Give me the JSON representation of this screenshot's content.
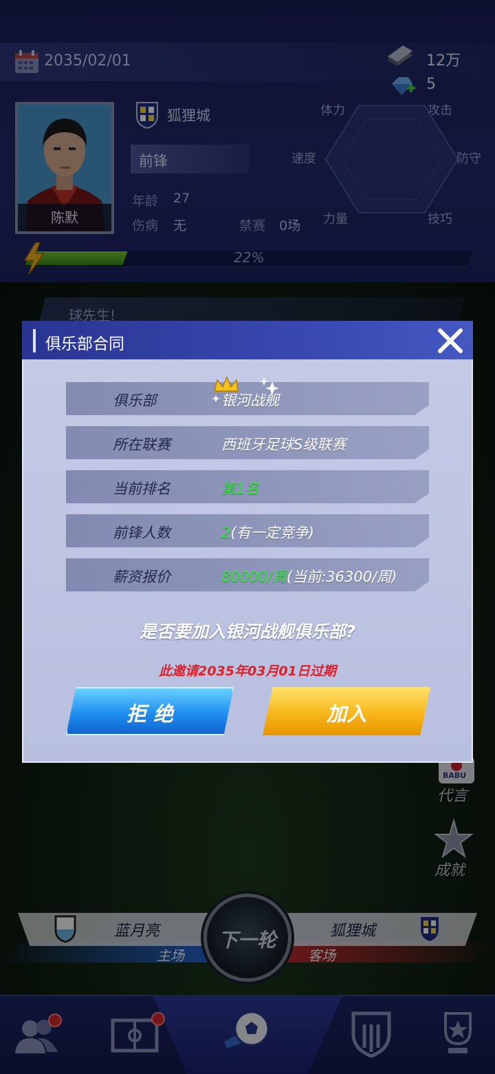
{
  "header": {
    "date": "2035/02/01",
    "money": "12万",
    "gems": "5",
    "player_name": "陈默",
    "club_name": "狐狸城",
    "position": "前锋",
    "age_label": "年龄",
    "age": "27",
    "injury_label": "伤病",
    "injury": "无",
    "ban_label": "禁赛",
    "ban": "0场",
    "energy_text": "22%",
    "energy_fraction": 0.22,
    "radar_labels": {
      "stamina": "体力",
      "attack": "攻击",
      "speed": "速度",
      "defense": "防守",
      "strength": "力量",
      "technique": "技巧"
    }
  },
  "background": {
    "banner_text": "球先生!",
    "side_buttons": [
      "代言",
      "成就"
    ],
    "sponsor_badge": "BABU"
  },
  "match": {
    "home_team": "蓝月亮",
    "home_label": "主场",
    "away_team": "狐狸城",
    "away_label": "客场",
    "next_round": "下一轮"
  },
  "dialog": {
    "title": "俱乐部合同",
    "rows": [
      {
        "label": "俱乐部",
        "value": "银河战舰",
        "value_suffix": ""
      },
      {
        "label": "所在联赛",
        "value": "西班牙足球S级联赛",
        "value_suffix": ""
      },
      {
        "label": "当前排名",
        "value": "第1名",
        "value_suffix": ""
      },
      {
        "label": "前锋人数",
        "value": "2",
        "value_suffix": "(有一定竞争)"
      },
      {
        "label": "薪资报价",
        "value": "80000/周",
        "value_suffix": "(当前:36300/周)"
      }
    ],
    "question": "是否要加入银河战舰俱乐部?",
    "expire_note": "此邀请2035年03月01日过期",
    "reject_label": "拒 绝",
    "accept_label": "加入"
  },
  "colors": {
    "accent_green": "#33e83a",
    "warning_red": "#e01f2a",
    "reject_blue": "#1f8ef0",
    "accept_gold": "#f7b71a"
  }
}
